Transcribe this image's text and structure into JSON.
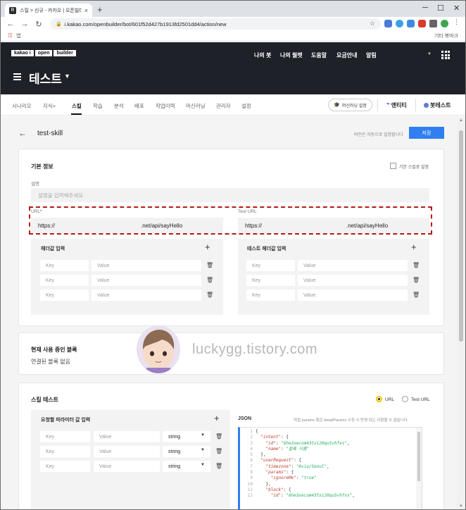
{
  "browser": {
    "tab_title": "스킬 > 신규 - 카카오 | 오픈빌더",
    "close_tab": "×",
    "new_tab": "+",
    "url": "i.kakao.com/openbuilder/bot/601f52d427b1913fd2501dd4/action/new",
    "bookmark_apps": "앱",
    "bookmark_other": "기타 북마크",
    "minimize": "─",
    "maximize": "☐",
    "close": "✕"
  },
  "header": {
    "logo": [
      "kakao i",
      "open",
      "builder"
    ],
    "nav": [
      "나의 봇",
      "나의 월렛",
      "도움말",
      "요금안내",
      "알림"
    ],
    "bot_title": "테스트"
  },
  "subnav": {
    "items": [
      "시나리오",
      "지식+",
      "스킬",
      "학습",
      "분석",
      "배포",
      "작업이력",
      "머신러닝",
      "관리자",
      "설정"
    ],
    "ml_button": "머신러닝 설정",
    "entity": "엔티티",
    "bot_test": "봇테스트"
  },
  "page": {
    "skill_name": "test-skill",
    "autosave": "버전은 자동으로 설정됩니다",
    "save": "저장"
  },
  "basic_info": {
    "title": "기본 정보",
    "default_skill_label": "기본 스킬로 설정",
    "desc_label": "설명",
    "desc_placeholder": "설명을 입력해주세요",
    "url_label": "URL",
    "url_required": "*",
    "url_value_a": "https://",
    "url_value_b": ".net/api/sayHello",
    "test_url_label": "Test URL",
    "test_url_a": "https://",
    "test_url_b": ".net/api/sayHello",
    "header_title": "헤더값 입력",
    "test_header_title": "테스트 헤더값 입력",
    "key_placeholder": "Key",
    "value_placeholder": "Value"
  },
  "connected": {
    "title": "현재 사용 중인 블록",
    "empty": "연결된 블록 없음"
  },
  "watermark": "luckygg.tistory.com",
  "skill_test": {
    "title": "스킬 테스트",
    "radio_url": "URL",
    "radio_test_url": "Test URL",
    "params_title": "요청할 파라미터 값 입력",
    "json_title": "JSON",
    "json_note": "직접 params 혹은 detailParams 수정 시 반영 되는 사항할 수 없습니다.",
    "key_placeholder": "Key",
    "value_placeholder": "Value",
    "type_value": "string",
    "json_lines": [
      "{",
      "  \"intent\": {",
      "    \"id\": \"6he3xecom43txi20qu5vhfxs\",",
      "    \"name\": \"블록 이름\"",
      "  },",
      "  \"userRequest\": {",
      "    \"timezone\": \"Asia/Seoul\",",
      "    \"params\": {",
      "      \"ignoreMe\": \"true\"",
      "    },",
      "    \"block\": {",
      "      \"id\": \"6he3xecom43txi20qu5vhfxs\","
    ]
  },
  "colors": {
    "accent": "#2f7ff0",
    "header_bg": "#1e2128",
    "highlight": "#b31b1b",
    "radio_on": "#f5c400"
  }
}
